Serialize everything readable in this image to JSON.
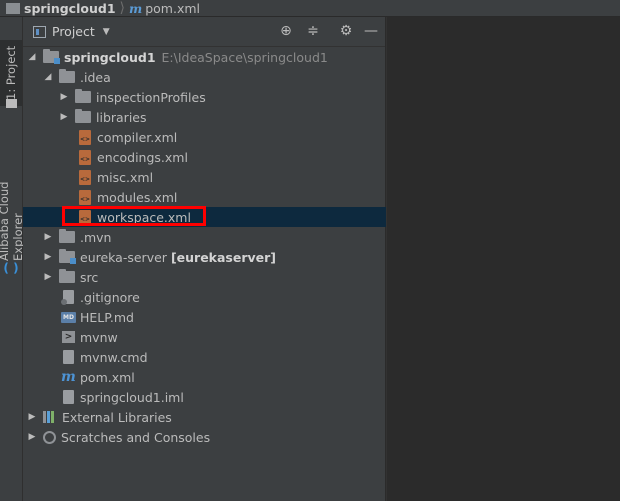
{
  "breadcrumb": {
    "root": "springcloud1",
    "file": "pom.xml",
    "m_glyph": "m"
  },
  "left_strip": {
    "project_tab": "1: Project",
    "alibaba_tab": "Alibaba Cloud Explorer"
  },
  "panel": {
    "title": "Project",
    "dropdown_arrow": "▼",
    "buttons": {
      "locate": "⊕",
      "collapse": "≑",
      "settings": "⚙",
      "hide": "—"
    }
  },
  "tree": {
    "root": {
      "label": "springcloud1",
      "path": "E:\\IdeaSpace\\springcloud1",
      "expanded": "◢"
    },
    "idea": {
      "label": ".idea"
    },
    "inspection_profiles": {
      "label": "inspectionProfiles"
    },
    "libraries": {
      "label": "libraries"
    },
    "compiler": {
      "label": "compiler.xml"
    },
    "encodings": {
      "label": "encodings.xml"
    },
    "misc": {
      "label": "misc.xml"
    },
    "modules": {
      "label": "modules.xml"
    },
    "workspace": {
      "label": "workspace.xml"
    },
    "mvn_dir": {
      "label": ".mvn"
    },
    "eureka": {
      "label": "eureka-server",
      "module": "[eurekaserver]"
    },
    "src": {
      "label": "src"
    },
    "gitignore": {
      "label": ".gitignore"
    },
    "help": {
      "label": "HELP.md",
      "badge": "MD"
    },
    "mvnw": {
      "label": "mvnw",
      "badge": ">"
    },
    "mvnw_cmd": {
      "label": "mvnw.cmd"
    },
    "pom": {
      "label": "pom.xml",
      "badge": "m"
    },
    "iml": {
      "label": "springcloud1.iml"
    },
    "external": {
      "label": "External Libraries"
    },
    "scratches": {
      "label": "Scratches and Consoles"
    }
  },
  "glyphs": {
    "collapsed": "▶",
    "expanded": "◢"
  },
  "colors": {
    "selection": "#0d293e",
    "highlight_box": "#ff0000",
    "maven_blue": "#4d93d4",
    "xml_orange": "#b86a3c"
  }
}
